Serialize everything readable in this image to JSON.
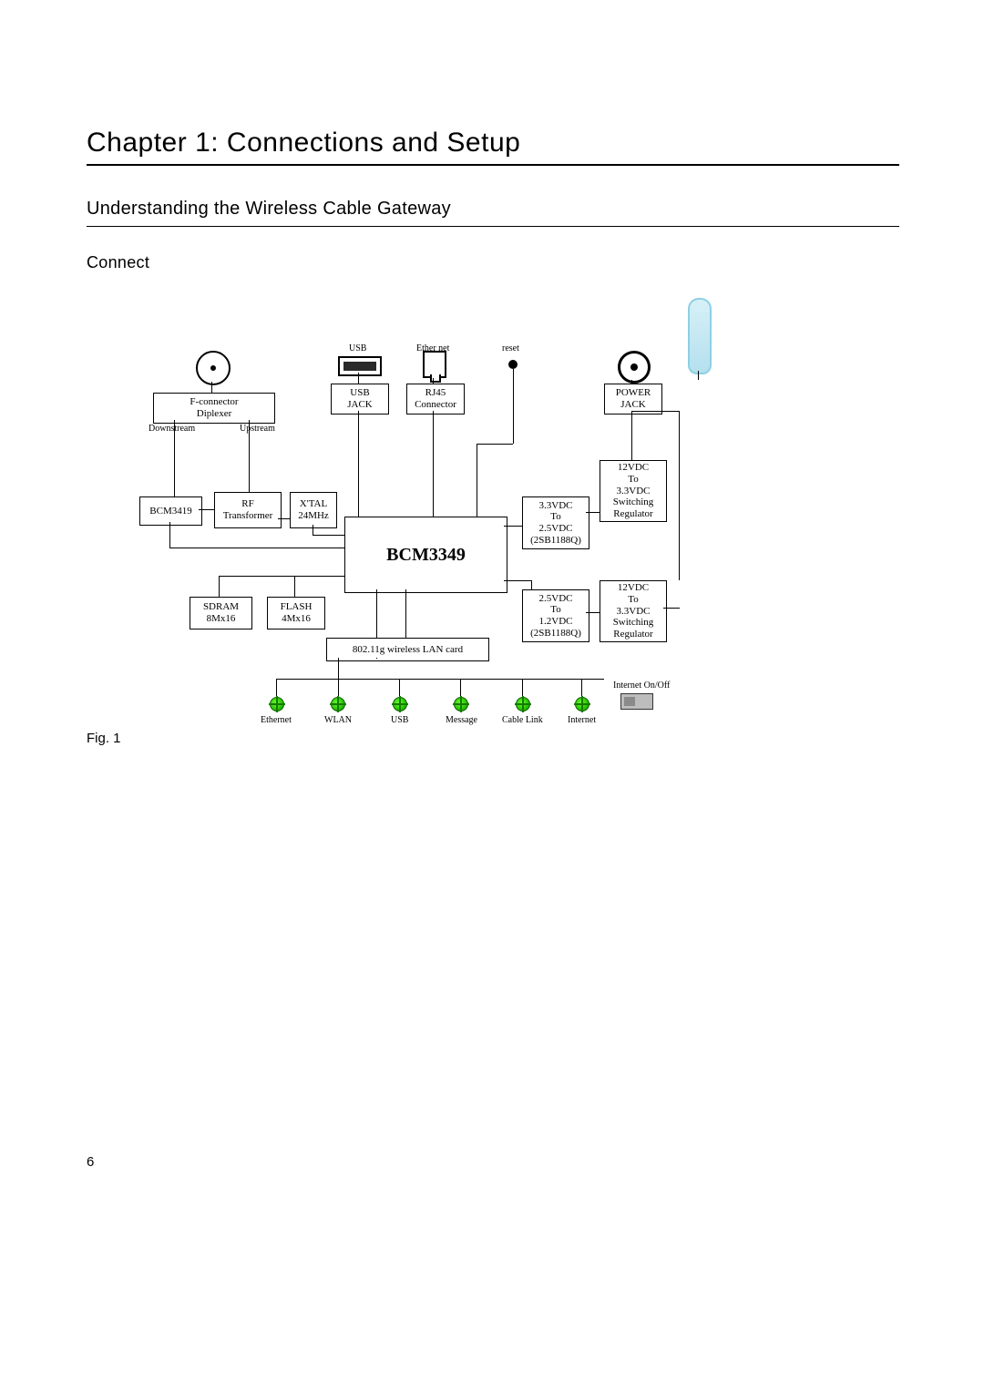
{
  "page_number": "6",
  "chapter_title": "Chapter 1: Connections and Setup",
  "section_title": "Understanding the Wireless Cable Gateway",
  "subsection_title": "Connect",
  "fig_caption": "Fig. 1",
  "diagram": {
    "top_labels": {
      "usb": "USB",
      "ethernet": "Ether net",
      "reset": "reset"
    },
    "connectors": {
      "f_connector": "F-connector\nDiplexer",
      "f_down": "Downstream",
      "f_up": "Upstream",
      "usb_jack": "USB\nJACK",
      "rj45": "RJ45\nConnector",
      "power_jack": "POWER\nJACK"
    },
    "blocks": {
      "bcm3419": "BCM3419",
      "rf_transformer": "RF\nTransformer",
      "xtal": "X'TAL\n24MHz",
      "bcm3349": "BCM3349",
      "sdram": "SDRAM\n8Mx16",
      "flash": "FLASH\n4Mx16",
      "wlan": "802.11g wireless LAN card",
      "reg33_25": "3.3VDC\nTo\n2.5VDC\n(2SB1188Q)",
      "reg25_12": "2.5VDC\nTo\n1.2VDC\n(2SB1188Q)",
      "sw12_33a": "12VDC\nTo\n3.3VDC\nSwitching\nRegulator",
      "sw12_33b": "12VDC\nTo\n3.3VDC\nSwitching\nRegulator"
    },
    "bottom": {
      "internet_onoff": "Internet On/Off",
      "leds": [
        "Ethernet",
        "WLAN",
        "USB",
        "Message",
        "Cable Link",
        "Internet"
      ]
    }
  }
}
